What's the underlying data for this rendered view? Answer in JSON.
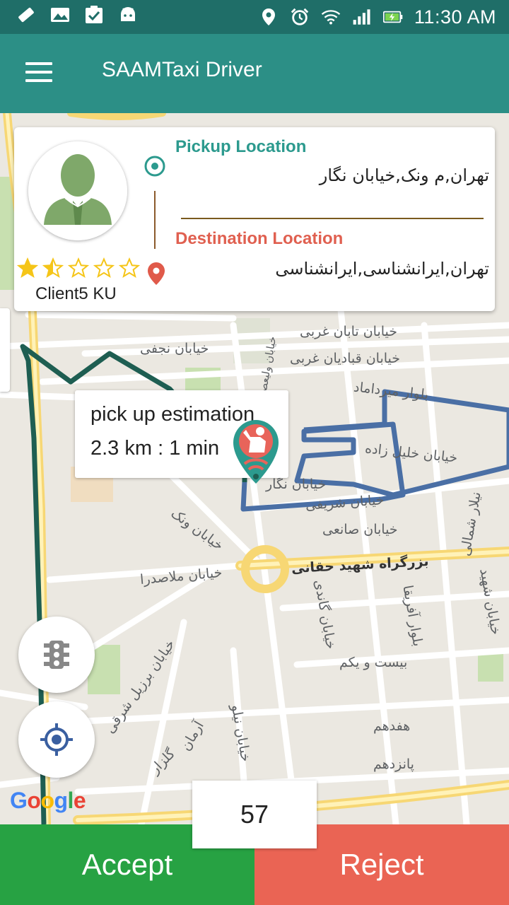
{
  "status_bar": {
    "time": "11:30 AM"
  },
  "app_bar": {
    "title": "SAAMTaxi Driver"
  },
  "ride": {
    "pickup_label": "Pickup Location",
    "pickup_address": "تهران,م ونک,خیابان نگار",
    "destination_label": "Destination Location",
    "destination_address": "تهران,ایرانشناسی,ایرانشناسی",
    "client_name": "Client5 KU",
    "rating": 1.5,
    "rating_max": 5
  },
  "estimate": {
    "title": "pick up estimation",
    "value": "2.3 km : 1 min"
  },
  "map": {
    "attribution": "Google",
    "streets": [
      "خیابان تابان غربی",
      "خیابان قبادیان غربی",
      "بلوار میرداماد",
      "خیابان خلیل زاده",
      "خیابان نجفی",
      "خیابان نگار",
      "خیابان شریفی",
      "خیابان صانعی",
      "بزرگراه شهید حقانی",
      "خیابان ونک",
      "خیابان ملاصدرا",
      "خیابان گاندی",
      "بلوار آفریقا",
      "بیست و یکم",
      "هفدهم",
      "پانزدهم",
      "گلزار",
      "آرمان",
      "خیابان نیلو",
      "خیابان برزیل شرقی",
      "نیلار شمالی",
      "خیابان شهید",
      "خیابان ولیعصر"
    ]
  },
  "countdown": "57",
  "actions": {
    "accept": "Accept",
    "reject": "Reject"
  },
  "colors": {
    "status_bar": "#1f6e68",
    "app_bar": "#2c8f86",
    "accept": "#27a243",
    "reject": "#ea6454",
    "route_driver": "#1e5e52",
    "route_trip": "#4a6fa5"
  }
}
